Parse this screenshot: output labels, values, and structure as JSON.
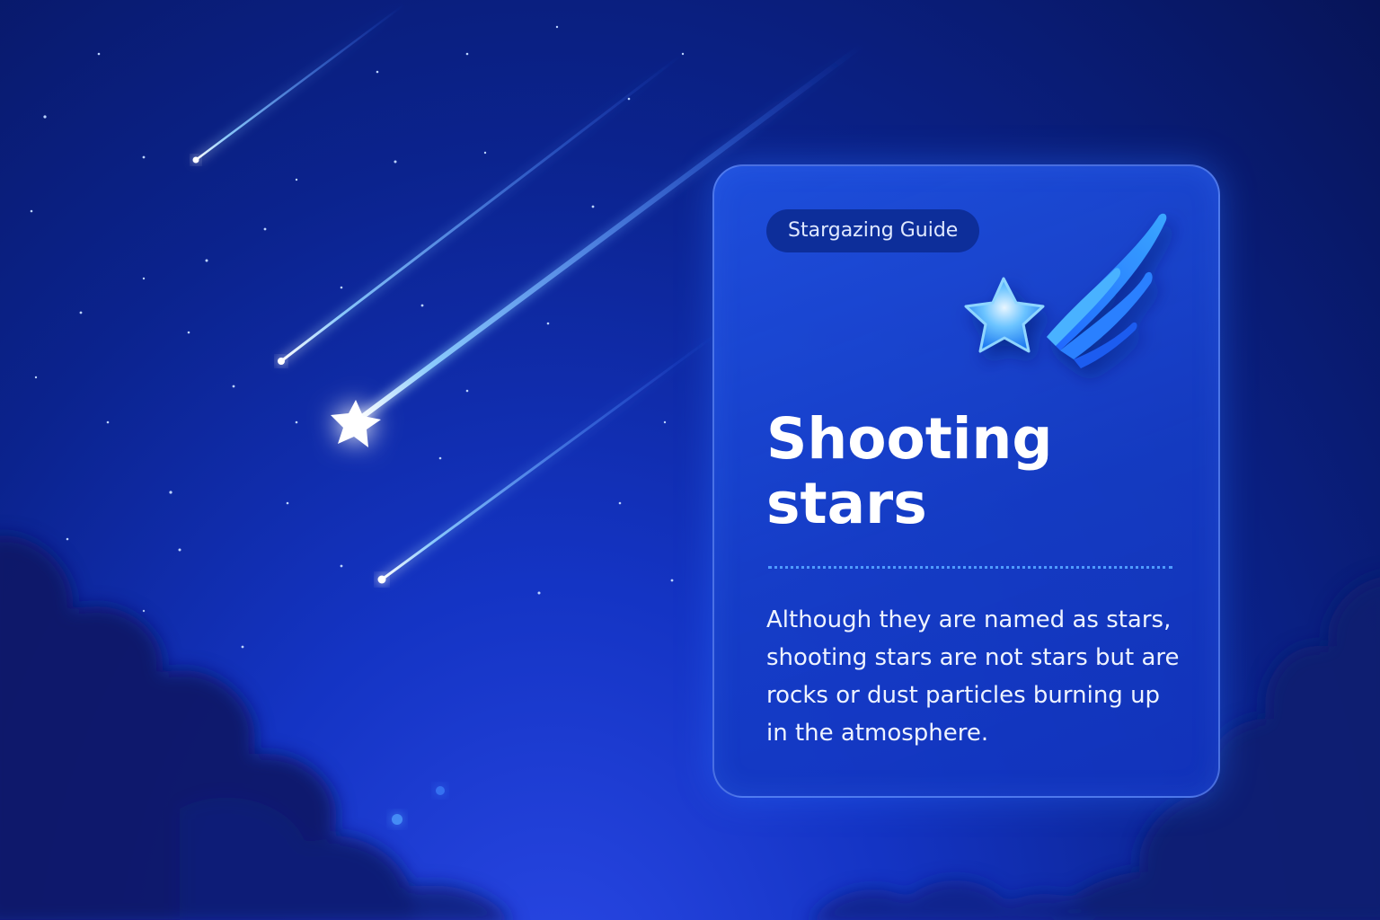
{
  "card": {
    "badge": "Stargazing Guide",
    "title": "Shooting stars",
    "body": "Although they are named as stars, shooting stars are not stars but are rocks or dust particles burning up in the atmosphere."
  },
  "icons": {
    "hero": "shooting-star-icon"
  },
  "colors": {
    "sky_dark": "#071458",
    "sky_mid": "#1434c4",
    "accent": "#4f9bff",
    "card": "#2052e2",
    "badge": "#0d2e9a"
  }
}
